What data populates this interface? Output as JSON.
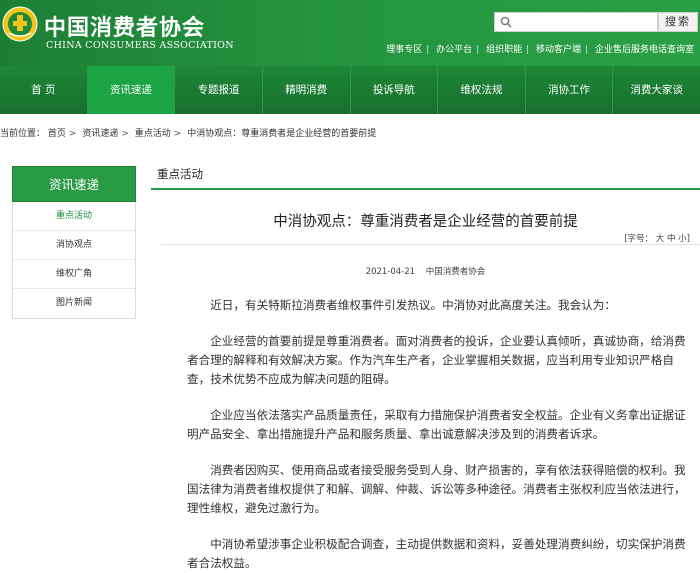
{
  "header": {
    "logo_cn": "中国消费者协会",
    "logo_en": "CHINA CONSUMERS ASSOCIATION",
    "search_placeholder": "",
    "search_button": "搜索",
    "top_links": [
      "理事专区",
      "办公平台",
      "组织职能",
      "移动客户端",
      "企业售后服务电话查询室"
    ]
  },
  "nav": {
    "items": [
      "首  页",
      "资讯速递",
      "专题报道",
      "精明消费",
      "投诉导航",
      "维权法规",
      "消协工作",
      "消费大家谈"
    ],
    "active_index": 1
  },
  "breadcrumb": {
    "prefix": "当前位置：",
    "items": [
      "首页",
      "资讯速递",
      "重点活动",
      "中消协观点：尊重消费者是企业经营的首要前提"
    ]
  },
  "sidebar": {
    "title": "资讯速递",
    "items": [
      "重点活动",
      "消协观点",
      "维权广角",
      "图片新闻"
    ],
    "active_index": 0
  },
  "main": {
    "section_title": "重点活动",
    "article_title": "中消协观点：尊重消费者是企业经营的首要前提",
    "font_size_label": "[字号：",
    "font_size_big": "大",
    "font_size_mid": "中",
    "font_size_small": "小",
    "font_size_end": "]",
    "date": "2021-04-21",
    "source": "中国消费者协会",
    "paragraphs": [
      "近日，有关特斯拉消费者维权事件引发热议。中消协对此高度关注。我会认为：",
      "企业经营的首要前提是尊重消费者。面对消费者的投诉，企业要认真倾听，真诚协商，给消费者合理的解释和有效解决方案。作为汽车生产者，企业掌握相关数据，应当利用专业知识严格自查，技术优势不应成为解决问题的阻碍。",
      "企业应当依法落实产品质量责任，采取有力措施保护消费者安全权益。企业有义务拿出证据证明产品安全、拿出措施提升产品和服务质量、拿出诚意解决涉及到的消费者诉求。",
      "消费者因购买、使用商品或者接受服务受到人身、财产损害的，享有依法获得赔偿的权利。我国法律为消费者维权提供了和解、调解、仲裁、诉讼等多种途径。消费者主张权利应当依法进行，理性维权，避免过激行为。",
      "中消协希望涉事企业积极配合调查，主动提供数据和资料，妥善处理消费纠纷，切实保护消费者合法权益。"
    ]
  },
  "colors": {
    "brand_green": "#1f8a3a",
    "accent_green": "#2a9a44"
  }
}
